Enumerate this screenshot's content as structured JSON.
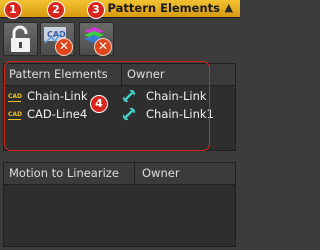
{
  "header": {
    "title": "Pattern Elements",
    "chevron": "▲"
  },
  "toolbar": {
    "buttons": [
      {
        "name": "lock",
        "icon": "lock-icon",
        "callout": "1"
      },
      {
        "name": "cad-remove",
        "icon": "cad-remove-icon",
        "callout": "2"
      },
      {
        "name": "motion-remove",
        "icon": "motion-remove-icon",
        "callout": "3"
      }
    ]
  },
  "pattern_table": {
    "callout": "4",
    "columns": [
      "Pattern Elements",
      "Owner"
    ],
    "rows": [
      {
        "element": "Chain-Link",
        "owner": "Chain-Link"
      },
      {
        "element": "CAD-Line4",
        "owner": "Chain-Link1"
      }
    ]
  },
  "motion_table": {
    "columns": [
      "Motion to Linearize",
      "Owner"
    ]
  },
  "colors": {
    "accent": "#f2c231",
    "callout": "#d9261c",
    "link": "#3fd2c8"
  }
}
